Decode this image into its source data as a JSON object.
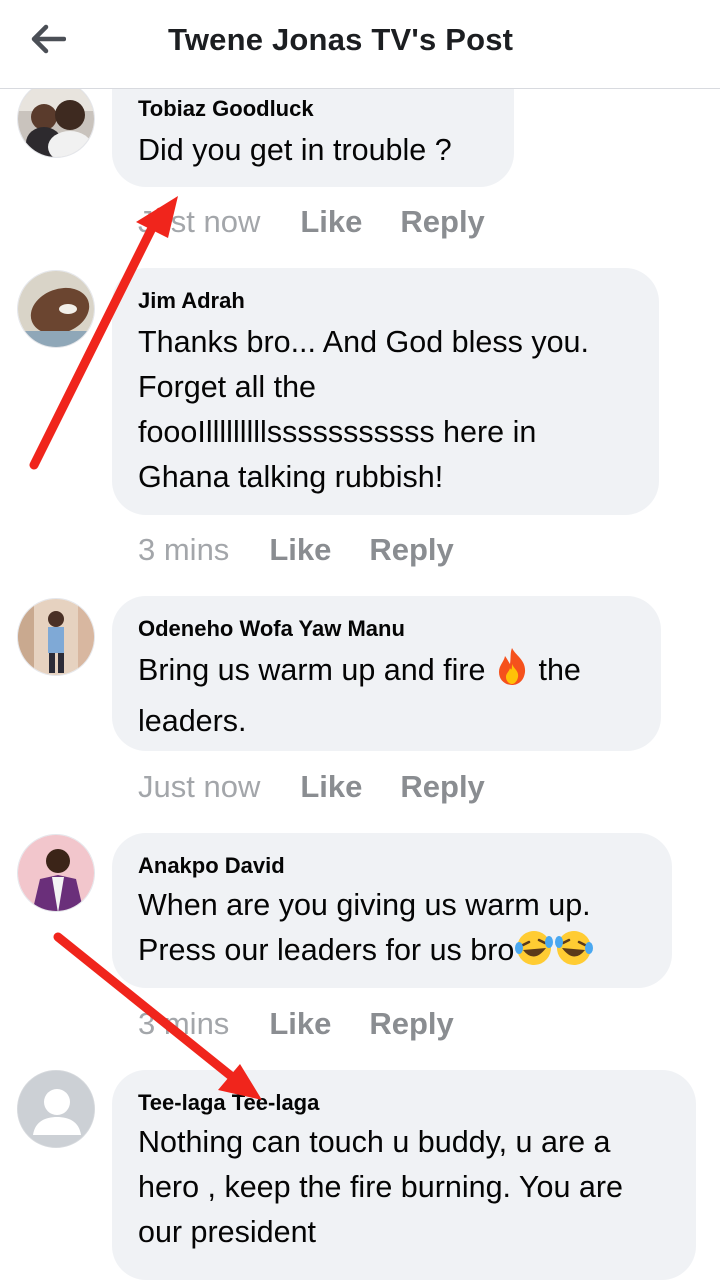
{
  "header": {
    "back_icon": "arrow-left-icon",
    "title": "Twene Jonas TV's Post"
  },
  "comments": [
    {
      "author": "Tobiaz Goodluck",
      "text": "Did you get in trouble ?",
      "time": "Just now",
      "like": "Like",
      "reply": "Reply"
    },
    {
      "author": "Jim Adrah",
      "text": "Thanks bro... And God bless you.\nForget all the\nfoooIlllllllllsssssssssss here in\nGhana talking rubbish!",
      "time": "3 mins",
      "like": "Like",
      "reply": "Reply"
    },
    {
      "author": "Odeneho Wofa Yaw Manu",
      "text_before_emoji": "Bring us warm up and fire ",
      "emoji": "fire-icon",
      "text_after_emoji": " the",
      "text_line2": "leaders.",
      "time": "Just now",
      "like": "Like",
      "reply": "Reply"
    },
    {
      "author": "Anakpo David",
      "text_line1": "When are you giving us warm up.",
      "text_line2": "Press our leaders for us bro",
      "emoji": "laughing-tears-icon",
      "time": "3 mins",
      "like": "Like",
      "reply": "Reply"
    },
    {
      "author": "Tee-laga Tee-laga",
      "text": "Nothing can touch u buddy, u are a\nhero , keep the fire burning. You are\nour president"
    }
  ],
  "colors": {
    "bubble": "#f0f2f5",
    "meta_text": "#8a8d91",
    "annotation_arrow": "#f0251c"
  }
}
